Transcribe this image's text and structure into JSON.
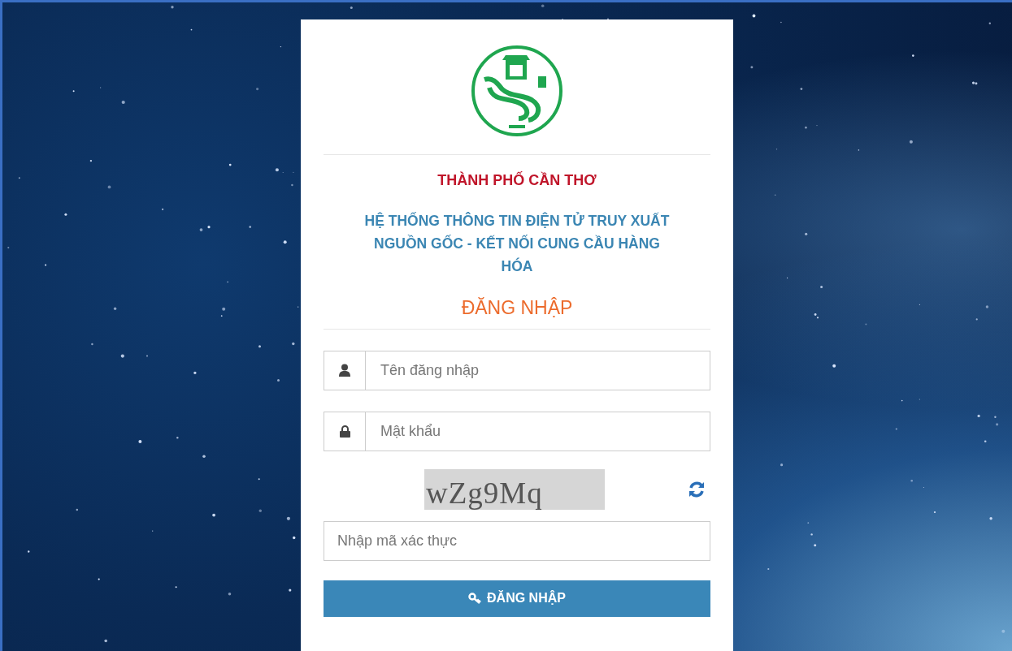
{
  "header": {
    "city": "THÀNH PHỐ CẦN THƠ",
    "system_title": "HỆ THỐNG THÔNG TIN ĐIỆN TỬ TRUY XUẤT NGUỒN GỐC - KẾT NỐI CUNG CẦU HÀNG HÓA",
    "login_heading": "ĐĂNG NHẬP"
  },
  "form": {
    "username": {
      "placeholder": "Tên đăng nhập"
    },
    "password": {
      "placeholder": "Mật khẩu"
    },
    "captcha": {
      "code": "wZg9Mq"
    },
    "captcha_input": {
      "placeholder": "Nhập mã xác thực"
    },
    "submit": {
      "label": "ĐĂNG NHẬP"
    }
  }
}
